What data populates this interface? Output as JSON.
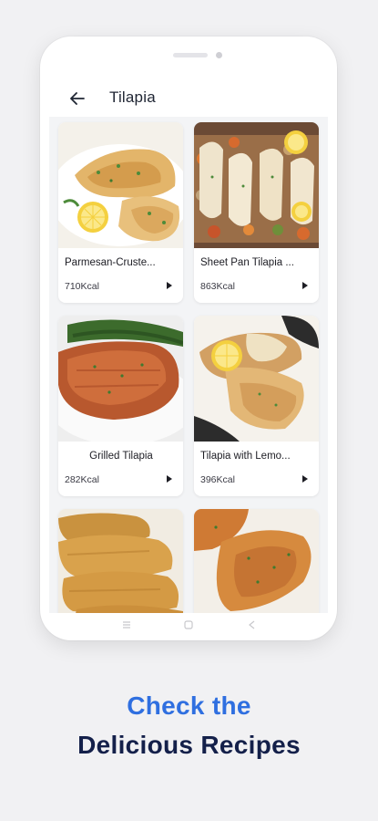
{
  "header": {
    "title": "Tilapia",
    "back_icon": "arrow-left-icon"
  },
  "recipes": [
    {
      "name": "Parmesan-Cruste...",
      "kcal": "710Kcal"
    },
    {
      "name": "Sheet Pan Tilapia ...",
      "kcal": "863Kcal"
    },
    {
      "name": "Grilled Tilapia",
      "kcal": "282Kcal"
    },
    {
      "name": "Tilapia with Lemo...",
      "kcal": "396Kcal"
    },
    {
      "name": "",
      "kcal": ""
    },
    {
      "name": "",
      "kcal": ""
    }
  ],
  "tagline": {
    "line1": "Check the",
    "line2": "Delicious Recipes"
  },
  "colors": {
    "accent": "#2f6fe0",
    "dark": "#14204a",
    "background": "#f1f1f3"
  },
  "icons": {
    "card_arrow": "chevron-right-icon",
    "nav": [
      "menu-icon",
      "home-icon",
      "back-icon"
    ]
  }
}
